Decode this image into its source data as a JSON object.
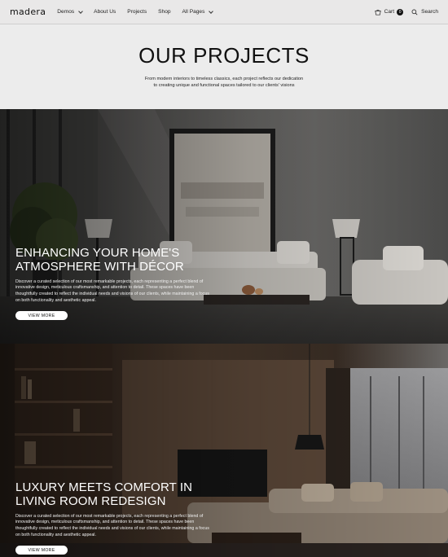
{
  "nav": {
    "logo": "madera",
    "links": [
      {
        "label": "Demos",
        "dropdown": true
      },
      {
        "label": "About Us",
        "dropdown": false
      },
      {
        "label": "Projects",
        "dropdown": false
      },
      {
        "label": "Shop",
        "dropdown": false
      },
      {
        "label": "All Pages",
        "dropdown": true
      }
    ],
    "cart_label": "Cart",
    "cart_count": "0",
    "search_label": "Search",
    "icons": {
      "cart": "cart-icon",
      "search": "search-icon"
    }
  },
  "intro": {
    "title": "OUR PROJECTS",
    "text": "From modern interiors to timeless classics, each project reflects our dedication to creating unique and functional spaces tailored to our clients' visions"
  },
  "projects": [
    {
      "title": "ENHANCING YOUR HOME'S ATMOSPHERE WITH DÉCOR",
      "description": "Discover a curated selection of our most remarkable projects, each representing a perfect blend of innovative design, meticulous craftsmanship, and attention to detail. These spaces have been thoughtfully created to reflect the individual needs and visions of our clients, while maintaining a focus on both functionality and aesthetic appeal.",
      "button": "VIEW MORE"
    },
    {
      "title": "LUXURY MEETS COMFORT IN LIVING ROOM REDESIGN",
      "description": "Discover a curated selection of our most remarkable projects, each representing a perfect blend of innovative design, meticulous craftsmanship, and attention to detail. These spaces have been thoughtfully created to reflect the individual needs and visions of our clients, while maintaining a focus on both functionality and aesthetic appeal.",
      "button": "VIEW MORE"
    }
  ],
  "colors": {
    "nav_bg": "#e9e8e8",
    "page_bg": "#ececec",
    "text": "#111111"
  }
}
